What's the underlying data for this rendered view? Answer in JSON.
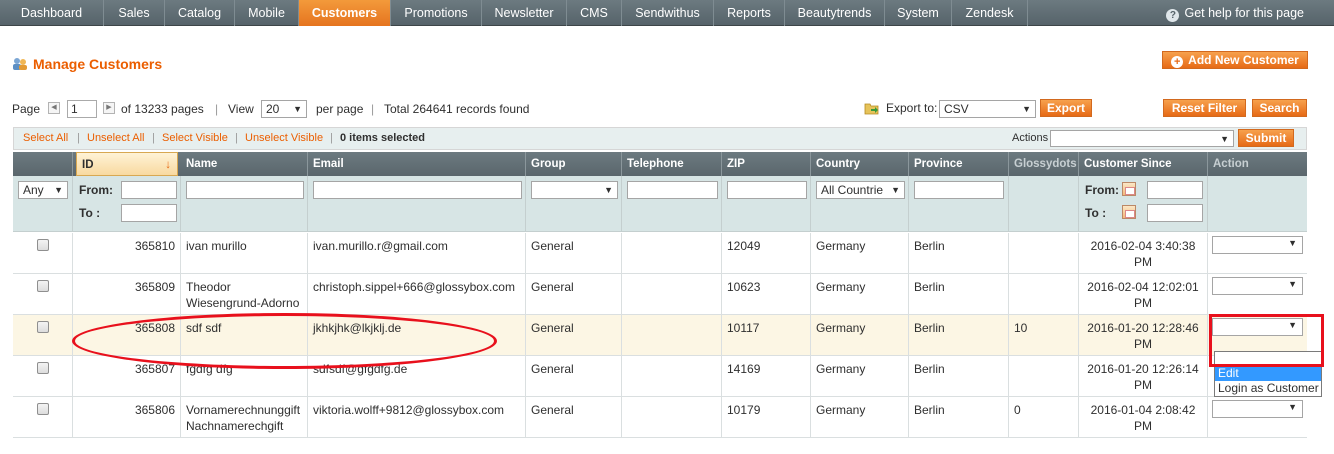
{
  "nav": {
    "items": [
      "Dashboard",
      "Sales",
      "Catalog",
      "Mobile",
      "Customers",
      "Promotions",
      "Newsletter",
      "CMS",
      "Sendwithus",
      "Reports",
      "Beautytrends",
      "System",
      "Zendesk"
    ],
    "active": "Customers",
    "help": "Get help for this page"
  },
  "header": {
    "title": "Manage Customers",
    "add_button": "Add New Customer"
  },
  "pager": {
    "page_label": "Page",
    "page_value": "1",
    "of_pages": "of 13233 pages",
    "sep1": "|",
    "view_label": "View",
    "view_value": "20",
    "per_page": "per page",
    "sep2": "|",
    "total": "Total 264641 records found",
    "export_label": "Export to:",
    "export_value": "CSV",
    "export_button": "Export",
    "reset_button": "Reset Filter",
    "search_button": "Search"
  },
  "mass": {
    "select_all": "Select All",
    "unselect_all": "Unselect All",
    "select_visible": "Select Visible",
    "unselect_visible": "Unselect Visible",
    "sep": "|",
    "selected": "0 items selected",
    "actions_label": "Actions",
    "submit": "Submit"
  },
  "grid": {
    "columns": [
      "ID",
      "Name",
      "Email",
      "Group",
      "Telephone",
      "ZIP",
      "Country",
      "Province",
      "Glossydots",
      "Customer Since",
      "Action"
    ],
    "filter": {
      "any": "Any",
      "from": "From:",
      "to": "To :",
      "country": "All Countrie"
    },
    "rows": [
      {
        "id": "365810",
        "name": "ivan murillo",
        "email": "ivan.murillo.r@gmail.com",
        "group": "General",
        "telephone": "",
        "zip": "12049",
        "country": "Germany",
        "province": "Berlin",
        "glossydots": "",
        "since": "2016-02-04 3:40:38 PM"
      },
      {
        "id": "365809",
        "name": "Theodor Wiesengrund-Adorno",
        "email": "christoph.sippel+666@glossybox.com",
        "group": "General",
        "telephone": "",
        "zip": "10623",
        "country": "Germany",
        "province": "Berlin",
        "glossydots": "",
        "since": "2016-02-04 12:02:01 PM"
      },
      {
        "id": "365808",
        "name": "sdf sdf",
        "email": "jkhkjhk@lkjklj.de",
        "group": "General",
        "telephone": "",
        "zip": "10117",
        "country": "Germany",
        "province": "Berlin",
        "glossydots": "10",
        "since": "2016-01-20 12:28:46 PM"
      },
      {
        "id": "365807",
        "name": "fgdfg dfg",
        "email": "sdfsdf@gfgdfg.de",
        "group": "General",
        "telephone": "",
        "zip": "14169",
        "country": "Germany",
        "province": "Berlin",
        "glossydots": "",
        "since": "2016-01-20 12:26:14 PM"
      },
      {
        "id": "365806",
        "name": "Vornamerechnunggift Nachnamerechgift",
        "email": "viktoria.wolff+9812@glossybox.com",
        "group": "General",
        "telephone": "",
        "zip": "10179",
        "country": "Germany",
        "province": "Berlin",
        "glossydots": "0",
        "since": "2016-01-04 2:08:42 PM"
      }
    ]
  },
  "action_dropdown": {
    "options": [
      "",
      "Edit",
      "Login as Customer"
    ],
    "highlighted": "Edit"
  },
  "colors": {
    "accent": "#eb5e00",
    "nav_active": "#e5741f",
    "annotation": "#e8101c",
    "highlight_row": "#fcf6e4"
  }
}
